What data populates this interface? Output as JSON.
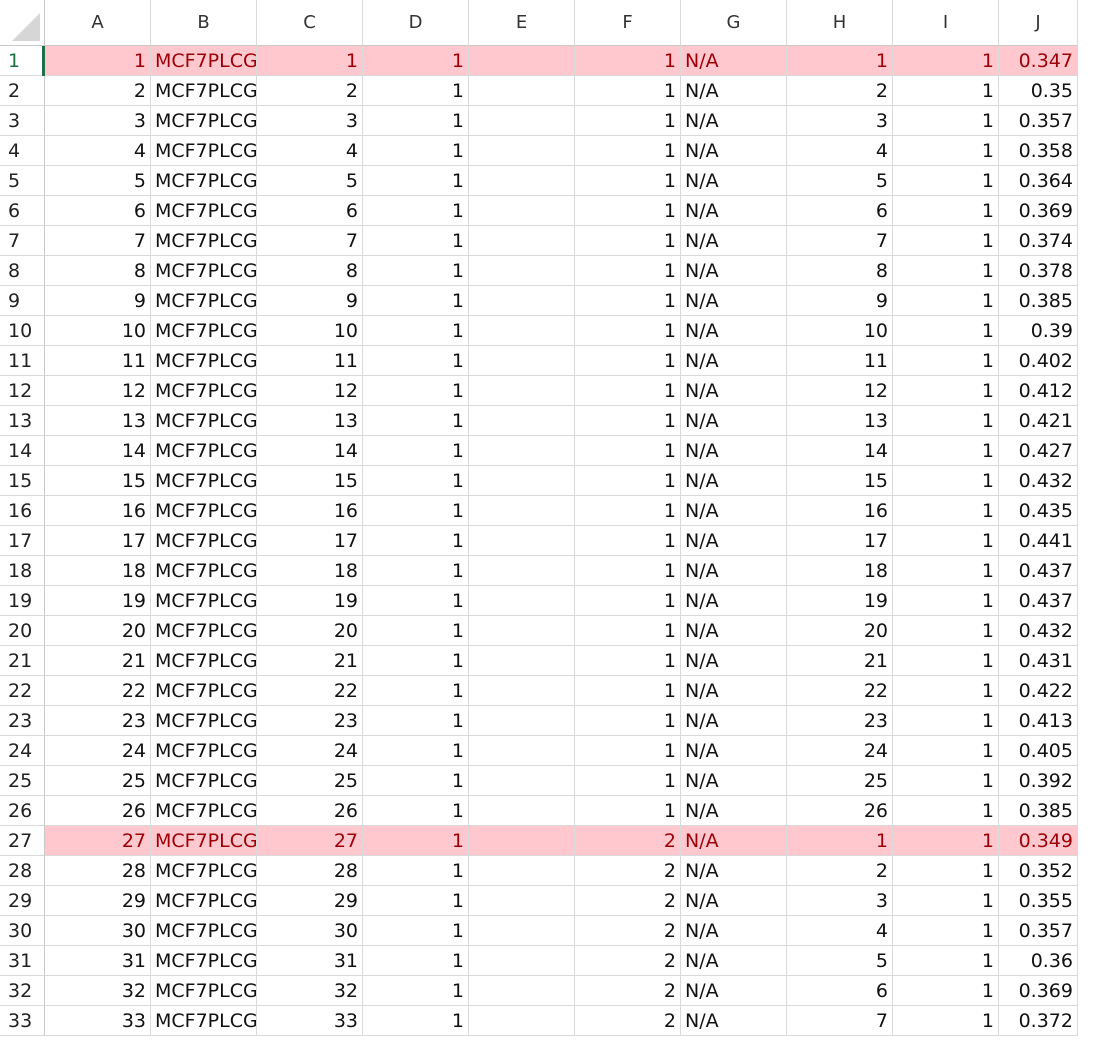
{
  "columns": [
    "A",
    "B",
    "C",
    "D",
    "E",
    "F",
    "G",
    "H",
    "I",
    "J"
  ],
  "highlight_color": "#ffc7ce",
  "highlight_text_color": "#9c0006",
  "selection_color": "#1e7145",
  "highlighted_rows": [
    1,
    27
  ],
  "selected_row": 1,
  "rows": [
    {
      "n": "1",
      "A": "1",
      "B": "MCF7PLCG",
      "C": "1",
      "D": "1",
      "E": "",
      "F": "1",
      "G": "N/A",
      "H": "1",
      "I": "1",
      "J": "0.347"
    },
    {
      "n": "2",
      "A": "2",
      "B": "MCF7PLCG",
      "C": "2",
      "D": "1",
      "E": "",
      "F": "1",
      "G": "N/A",
      "H": "2",
      "I": "1",
      "J": "0.35"
    },
    {
      "n": "3",
      "A": "3",
      "B": "MCF7PLCG",
      "C": "3",
      "D": "1",
      "E": "",
      "F": "1",
      "G": "N/A",
      "H": "3",
      "I": "1",
      "J": "0.357"
    },
    {
      "n": "4",
      "A": "4",
      "B": "MCF7PLCG",
      "C": "4",
      "D": "1",
      "E": "",
      "F": "1",
      "G": "N/A",
      "H": "4",
      "I": "1",
      "J": "0.358"
    },
    {
      "n": "5",
      "A": "5",
      "B": "MCF7PLCG",
      "C": "5",
      "D": "1",
      "E": "",
      "F": "1",
      "G": "N/A",
      "H": "5",
      "I": "1",
      "J": "0.364"
    },
    {
      "n": "6",
      "A": "6",
      "B": "MCF7PLCG",
      "C": "6",
      "D": "1",
      "E": "",
      "F": "1",
      "G": "N/A",
      "H": "6",
      "I": "1",
      "J": "0.369"
    },
    {
      "n": "7",
      "A": "7",
      "B": "MCF7PLCG",
      "C": "7",
      "D": "1",
      "E": "",
      "F": "1",
      "G": "N/A",
      "H": "7",
      "I": "1",
      "J": "0.374"
    },
    {
      "n": "8",
      "A": "8",
      "B": "MCF7PLCG",
      "C": "8",
      "D": "1",
      "E": "",
      "F": "1",
      "G": "N/A",
      "H": "8",
      "I": "1",
      "J": "0.378"
    },
    {
      "n": "9",
      "A": "9",
      "B": "MCF7PLCG",
      "C": "9",
      "D": "1",
      "E": "",
      "F": "1",
      "G": "N/A",
      "H": "9",
      "I": "1",
      "J": "0.385"
    },
    {
      "n": "10",
      "A": "10",
      "B": "MCF7PLCG",
      "C": "10",
      "D": "1",
      "E": "",
      "F": "1",
      "G": "N/A",
      "H": "10",
      "I": "1",
      "J": "0.39"
    },
    {
      "n": "11",
      "A": "11",
      "B": "MCF7PLCG",
      "C": "11",
      "D": "1",
      "E": "",
      "F": "1",
      "G": "N/A",
      "H": "11",
      "I": "1",
      "J": "0.402"
    },
    {
      "n": "12",
      "A": "12",
      "B": "MCF7PLCG",
      "C": "12",
      "D": "1",
      "E": "",
      "F": "1",
      "G": "N/A",
      "H": "12",
      "I": "1",
      "J": "0.412"
    },
    {
      "n": "13",
      "A": "13",
      "B": "MCF7PLCG",
      "C": "13",
      "D": "1",
      "E": "",
      "F": "1",
      "G": "N/A",
      "H": "13",
      "I": "1",
      "J": "0.421"
    },
    {
      "n": "14",
      "A": "14",
      "B": "MCF7PLCG",
      "C": "14",
      "D": "1",
      "E": "",
      "F": "1",
      "G": "N/A",
      "H": "14",
      "I": "1",
      "J": "0.427"
    },
    {
      "n": "15",
      "A": "15",
      "B": "MCF7PLCG",
      "C": "15",
      "D": "1",
      "E": "",
      "F": "1",
      "G": "N/A",
      "H": "15",
      "I": "1",
      "J": "0.432"
    },
    {
      "n": "16",
      "A": "16",
      "B": "MCF7PLCG",
      "C": "16",
      "D": "1",
      "E": "",
      "F": "1",
      "G": "N/A",
      "H": "16",
      "I": "1",
      "J": "0.435"
    },
    {
      "n": "17",
      "A": "17",
      "B": "MCF7PLCG",
      "C": "17",
      "D": "1",
      "E": "",
      "F": "1",
      "G": "N/A",
      "H": "17",
      "I": "1",
      "J": "0.441"
    },
    {
      "n": "18",
      "A": "18",
      "B": "MCF7PLCG",
      "C": "18",
      "D": "1",
      "E": "",
      "F": "1",
      "G": "N/A",
      "H": "18",
      "I": "1",
      "J": "0.437"
    },
    {
      "n": "19",
      "A": "19",
      "B": "MCF7PLCG",
      "C": "19",
      "D": "1",
      "E": "",
      "F": "1",
      "G": "N/A",
      "H": "19",
      "I": "1",
      "J": "0.437"
    },
    {
      "n": "20",
      "A": "20",
      "B": "MCF7PLCG",
      "C": "20",
      "D": "1",
      "E": "",
      "F": "1",
      "G": "N/A",
      "H": "20",
      "I": "1",
      "J": "0.432"
    },
    {
      "n": "21",
      "A": "21",
      "B": "MCF7PLCG",
      "C": "21",
      "D": "1",
      "E": "",
      "F": "1",
      "G": "N/A",
      "H": "21",
      "I": "1",
      "J": "0.431"
    },
    {
      "n": "22",
      "A": "22",
      "B": "MCF7PLCG",
      "C": "22",
      "D": "1",
      "E": "",
      "F": "1",
      "G": "N/A",
      "H": "22",
      "I": "1",
      "J": "0.422"
    },
    {
      "n": "23",
      "A": "23",
      "B": "MCF7PLCG",
      "C": "23",
      "D": "1",
      "E": "",
      "F": "1",
      "G": "N/A",
      "H": "23",
      "I": "1",
      "J": "0.413"
    },
    {
      "n": "24",
      "A": "24",
      "B": "MCF7PLCG",
      "C": "24",
      "D": "1",
      "E": "",
      "F": "1",
      "G": "N/A",
      "H": "24",
      "I": "1",
      "J": "0.405"
    },
    {
      "n": "25",
      "A": "25",
      "B": "MCF7PLCG",
      "C": "25",
      "D": "1",
      "E": "",
      "F": "1",
      "G": "N/A",
      "H": "25",
      "I": "1",
      "J": "0.392"
    },
    {
      "n": "26",
      "A": "26",
      "B": "MCF7PLCG",
      "C": "26",
      "D": "1",
      "E": "",
      "F": "1",
      "G": "N/A",
      "H": "26",
      "I": "1",
      "J": "0.385"
    },
    {
      "n": "27",
      "A": "27",
      "B": "MCF7PLCG",
      "C": "27",
      "D": "1",
      "E": "",
      "F": "2",
      "G": "N/A",
      "H": "1",
      "I": "1",
      "J": "0.349"
    },
    {
      "n": "28",
      "A": "28",
      "B": "MCF7PLCG",
      "C": "28",
      "D": "1",
      "E": "",
      "F": "2",
      "G": "N/A",
      "H": "2",
      "I": "1",
      "J": "0.352"
    },
    {
      "n": "29",
      "A": "29",
      "B": "MCF7PLCG",
      "C": "29",
      "D": "1",
      "E": "",
      "F": "2",
      "G": "N/A",
      "H": "3",
      "I": "1",
      "J": "0.355"
    },
    {
      "n": "30",
      "A": "30",
      "B": "MCF7PLCG",
      "C": "30",
      "D": "1",
      "E": "",
      "F": "2",
      "G": "N/A",
      "H": "4",
      "I": "1",
      "J": "0.357"
    },
    {
      "n": "31",
      "A": "31",
      "B": "MCF7PLCG",
      "C": "31",
      "D": "1",
      "E": "",
      "F": "2",
      "G": "N/A",
      "H": "5",
      "I": "1",
      "J": "0.36"
    },
    {
      "n": "32",
      "A": "32",
      "B": "MCF7PLCG",
      "C": "32",
      "D": "1",
      "E": "",
      "F": "2",
      "G": "N/A",
      "H": "6",
      "I": "1",
      "J": "0.369"
    },
    {
      "n": "33",
      "A": "33",
      "B": "MCF7PLCG",
      "C": "33",
      "D": "1",
      "E": "",
      "F": "2",
      "G": "N/A",
      "H": "7",
      "I": "1",
      "J": "0.372"
    }
  ]
}
